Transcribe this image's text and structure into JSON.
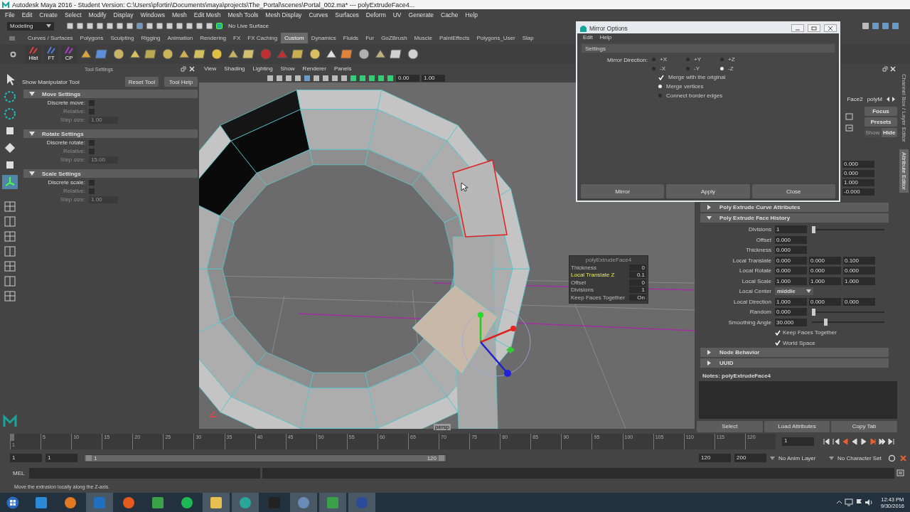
{
  "window": {
    "title": "Autodesk Maya 2016 - Student Version: C:\\Users\\pfortin\\Documents\\maya\\projects\\The_Portal\\scenes\\Portal_002.ma*   ---   polyExtrudeFace4..."
  },
  "menu": [
    "File",
    "Edit",
    "Create",
    "Select",
    "Modify",
    "Display",
    "Windows",
    "Mesh",
    "Edit Mesh",
    "Mesh Tools",
    "Mesh Display",
    "Curves",
    "Surfaces",
    "Deform",
    "UV",
    "Generate",
    "Cache",
    "Help"
  ],
  "status_line": {
    "mode": "Modeling",
    "live_surface": "No Live Surface"
  },
  "shelf_tabs": [
    {
      "label": "Curves / Surfaces",
      "selected": false
    },
    {
      "label": "Polygons",
      "selected": false
    },
    {
      "label": "Sculpting",
      "selected": false
    },
    {
      "label": "Rigging",
      "selected": false
    },
    {
      "label": "Animation",
      "selected": false
    },
    {
      "label": "Rendering",
      "selected": false
    },
    {
      "label": "FX",
      "selected": false
    },
    {
      "label": "FX Caching",
      "selected": false
    },
    {
      "label": "Custom",
      "selected": true
    },
    {
      "label": "Dynamics",
      "selected": false
    },
    {
      "label": "Fluids",
      "selected": false
    },
    {
      "label": "Fur",
      "selected": false
    },
    {
      "label": "GoZBrush",
      "selected": false
    },
    {
      "label": "Muscle",
      "selected": false
    },
    {
      "label": "PaintEffects",
      "selected": false
    },
    {
      "label": "Polygons_User",
      "selected": false
    },
    {
      "label": "Slap",
      "selected": false
    }
  ],
  "shelf_labels": [
    "Hist",
    "FT",
    "CP"
  ],
  "tool_settings": {
    "title": "Tool Settings",
    "tool": "Show Manipulator Tool",
    "buttons": [
      "Reset Tool",
      "Tool Help"
    ],
    "sections": [
      {
        "title": "Move Settings",
        "expanded": true,
        "rows": [
          {
            "label": "Discrete move:",
            "kind": "check",
            "checked": false,
            "disabled": false
          },
          {
            "label": "Relative:",
            "kind": "check",
            "checked": false,
            "disabled": true
          },
          {
            "label": "Step size:",
            "kind": "field",
            "value": "1.00",
            "disabled": true
          }
        ]
      },
      {
        "title": "Rotate Settings",
        "expanded": true,
        "rows": [
          {
            "label": "Discrete rotate:",
            "kind": "check",
            "checked": false,
            "disabled": false
          },
          {
            "label": "Relative:",
            "kind": "check",
            "checked": false,
            "disabled": true
          },
          {
            "label": "Step size:",
            "kind": "field",
            "value": "15.00",
            "disabled": true
          }
        ]
      },
      {
        "title": "Scale Settings",
        "expanded": true,
        "rows": [
          {
            "label": "Discrete scale:",
            "kind": "check",
            "checked": false,
            "disabled": false
          },
          {
            "label": "Relative:",
            "kind": "check",
            "checked": false,
            "disabled": true
          },
          {
            "label": "Step size:",
            "kind": "field",
            "value": "1.00",
            "disabled": true
          }
        ]
      }
    ]
  },
  "viewport": {
    "menu": [
      "View",
      "Shading",
      "Lighting",
      "Show",
      "Renderer",
      "Panels"
    ],
    "fields": [
      "0.00",
      "1.00"
    ],
    "camera": "persp",
    "hud": {
      "title": "polyExtrudeFace4",
      "rows": [
        {
          "label": "Thickness",
          "value": "0",
          "selected": false
        },
        {
          "label": "Local Translate Z",
          "value": "0.1",
          "selected": true
        },
        {
          "label": "Offset",
          "value": "0",
          "selected": false
        },
        {
          "label": "Divisions",
          "value": "1",
          "selected": false
        },
        {
          "label": "Keep Faces Together",
          "value": "On",
          "selected": false
        }
      ]
    }
  },
  "attribute_editor": {
    "tabs": [
      "Face2",
      "polyM"
    ],
    "focus_buttons": [
      {
        "label": "Focus",
        "disabled": false
      },
      {
        "label": "Presets",
        "disabled": false
      },
      {
        "label": "Show",
        "disabled": true
      },
      {
        "label": "Hide",
        "disabled": false
      }
    ],
    "top_fields": [
      "0.000",
      "0.000",
      "1.000",
      "-0.000"
    ],
    "sections": [
      {
        "title": "Poly Extrude Curve Attributes",
        "expanded": false
      },
      {
        "title": "Poly Extrude Face History",
        "expanded": true,
        "rows": [
          {
            "kind": "slider",
            "label": "Divisions",
            "value": "1",
            "level": 0.0
          },
          {
            "kind": "field",
            "label": "Offset",
            "value": "0.000"
          },
          {
            "kind": "field",
            "label": "Thickness",
            "value": "0.000"
          },
          {
            "kind": "triple",
            "label": "Local Translate",
            "values": [
              "0.000",
              "0.000",
              "0.100"
            ]
          },
          {
            "kind": "triple",
            "label": "Local Rotate",
            "values": [
              "0.000",
              "0.000",
              "0.000"
            ]
          },
          {
            "kind": "triple",
            "label": "Local Scale",
            "values": [
              "1.000",
              "1.000",
              "1.000"
            ]
          },
          {
            "kind": "dropdown",
            "label": "Local Center",
            "value": "middle"
          },
          {
            "kind": "triple",
            "label": "Local Direction",
            "values": [
              "1.000",
              "0.000",
              "0.000"
            ]
          },
          {
            "kind": "slider",
            "label": "Random",
            "value": "0.000",
            "level": 0.0
          },
          {
            "kind": "slider",
            "label": "Smoothing Angle",
            "value": "30.000",
            "level": 0.17
          },
          {
            "kind": "check",
            "label": "Keep Faces Together",
            "checked": true
          },
          {
            "kind": "check",
            "label": "World Space",
            "checked": true
          }
        ]
      },
      {
        "title": "Node Behavior",
        "expanded": false
      },
      {
        "title": "UUID",
        "expanded": false
      }
    ],
    "notes": "Notes:  polyExtrudeFace4",
    "buttons": [
      "Select",
      "Load Attributes",
      "Copy Tab"
    ]
  },
  "side_tabs": [
    {
      "label": "Channel Box / Layer Editor",
      "selected": false
    },
    {
      "label": "Attribute Editor",
      "selected": true
    }
  ],
  "mirror_dialog": {
    "title": "Mirror Options",
    "menu": [
      "Edit",
      "Help"
    ],
    "section": "Settings",
    "direction_label": "Mirror Direction:",
    "directions": [
      {
        "label": "+X",
        "selected": false
      },
      {
        "label": "+Y",
        "selected": false
      },
      {
        "label": "+Z",
        "selected": false
      },
      {
        "label": "-X",
        "selected": false
      },
      {
        "label": "-Y",
        "selected": false
      },
      {
        "label": "-Z",
        "selected": true
      }
    ],
    "options": [
      {
        "kind": "check",
        "label": "Merge with the original",
        "checked": true
      },
      {
        "kind": "radio",
        "label": "Merge vertices",
        "selected": true
      },
      {
        "kind": "radio",
        "label": "Connect border edges",
        "selected": false
      }
    ],
    "buttons": [
      "Mirror",
      "Apply",
      "Close"
    ]
  },
  "time_slider": {
    "ticks": [
      "1",
      "5",
      "10",
      "15",
      "20",
      "25",
      "30",
      "35",
      "40",
      "45",
      "50",
      "55",
      "60",
      "65",
      "70",
      "75",
      "80",
      "85",
      "90",
      "95",
      "100",
      "105",
      "110",
      "115",
      "120"
    ],
    "current_frame": "1",
    "level": 0.0
  },
  "range": {
    "start": "1",
    "playback_start": "1",
    "slider_start": "1",
    "slider_end": "120",
    "level": 1.0,
    "playback_end": "120",
    "end": "200",
    "anim_layer": "No Anim Layer",
    "character_set": "No Character Set"
  },
  "command_line": {
    "label": "MEL"
  },
  "help_line": "Move the extrusion locally along the Z-axis.",
  "taskbar": {
    "apps": [
      {
        "active": false
      },
      {
        "active": false
      },
      {
        "active": true
      },
      {
        "active": false
      },
      {
        "active": false
      },
      {
        "active": false
      },
      {
        "active": true
      },
      {
        "active": true
      },
      {
        "active": false
      },
      {
        "active": true
      },
      {
        "active": true
      },
      {
        "active": true
      }
    ],
    "time": "12:43 PM",
    "date": "9/30/2016"
  }
}
